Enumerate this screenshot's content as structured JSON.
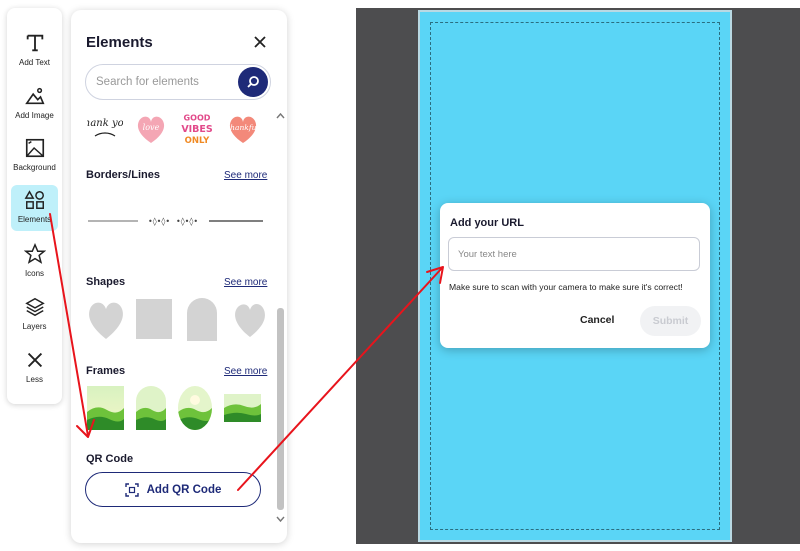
{
  "rail": {
    "items": [
      {
        "label": "Add Text",
        "icon": "text-icon"
      },
      {
        "label": "Add Image",
        "icon": "image-icon"
      },
      {
        "label": "Background",
        "icon": "background-icon"
      },
      {
        "label": "Elements",
        "icon": "elements-icon",
        "active": true
      },
      {
        "label": "Icons",
        "icon": "star-icon"
      },
      {
        "label": "Layers",
        "icon": "layers-icon"
      },
      {
        "label": "Less",
        "icon": "close-icon"
      }
    ]
  },
  "panel": {
    "title": "Elements",
    "search_placeholder": "Search for elements",
    "stickers": [
      {
        "text": "thank you",
        "icon": "thank-you-sticker"
      },
      {
        "text": "love",
        "icon": "pink-heart-sticker"
      },
      {
        "text": "GOOD VIBES ONLY",
        "icon": "good-vibes-sticker"
      },
      {
        "text": "thankful",
        "icon": "thankful-heart-sticker"
      }
    ],
    "sections": {
      "borders": {
        "title": "Borders/Lines",
        "see_more": "See more"
      },
      "shapes": {
        "title": "Shapes",
        "see_more": "See more"
      },
      "frames": {
        "title": "Frames",
        "see_more": "See more"
      },
      "qr": {
        "title": "QR Code",
        "button": "Add QR Code"
      }
    }
  },
  "dialog": {
    "title": "Add your URL",
    "input_placeholder": "Your text here",
    "hint": "Make sure to scan with your camera to make sure it's correct!",
    "cancel": "Cancel",
    "submit": "Submit"
  },
  "colors": {
    "accent": "#1e2a78",
    "canvas": "#5ad5f6",
    "active_rail": "#bff0fa",
    "annotation_arrow": "#e8141c"
  }
}
